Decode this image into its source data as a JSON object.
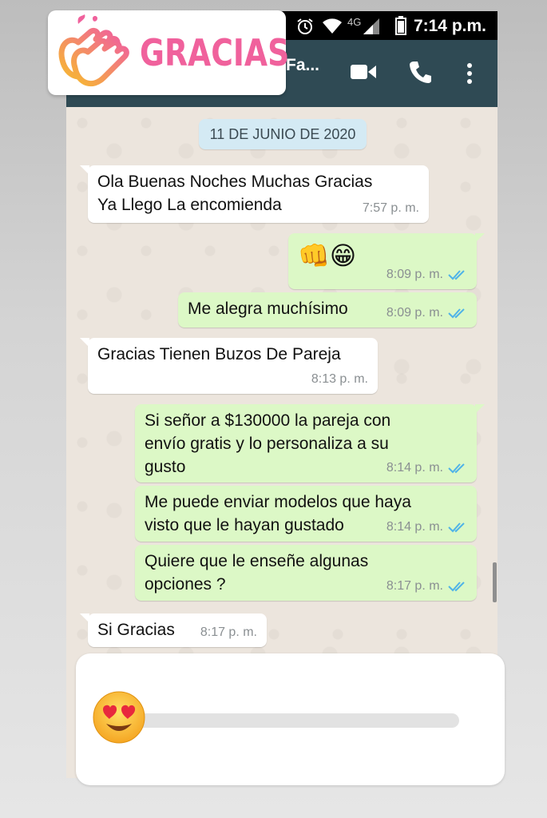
{
  "status_bar": {
    "network": "4G",
    "time": "7:14 p.m.",
    "icons": [
      "alarm-icon",
      "wifi-icon",
      "signal-icon",
      "battery-icon"
    ]
  },
  "app_bar": {
    "contact_name": "Fa...",
    "icons": [
      "video-call-icon",
      "phone-call-icon",
      "more-options-icon"
    ]
  },
  "sticker": {
    "text": "GRACIAS",
    "icon": "clapping-hands-icon",
    "color": "#f0619c"
  },
  "chat": {
    "date": "11 DE JUNIO DE 2020",
    "messages": [
      {
        "dir": "in",
        "lines": [
          "Ola Buenas Noches Muchas Gracias",
          "Ya Llego La encomienda"
        ],
        "time": "7:57 p. m."
      },
      {
        "dir": "out",
        "lines": [
          "👊😁"
        ],
        "time": "8:09 p. m.",
        "read": true
      },
      {
        "dir": "out",
        "lines": [
          "Me alegra muchísimo"
        ],
        "time": "8:09 p. m.",
        "read": true
      },
      {
        "dir": "in",
        "lines": [
          "Gracias Tienen Buzos De Pareja"
        ],
        "time": "8:13 p. m."
      },
      {
        "dir": "out",
        "lines": [
          "Si señor a $130000 la pareja con",
          "envío gratis y lo personaliza a su",
          "gusto"
        ],
        "time": "8:14 p. m.",
        "read": true
      },
      {
        "dir": "out",
        "lines": [
          "Me puede enviar modelos que haya",
          "visto que le hayan gustado"
        ],
        "time": "8:14 p. m.",
        "read": true
      },
      {
        "dir": "out",
        "lines": [
          "Quiere que le enseñe algunas",
          "opciones ?"
        ],
        "time": "8:17 p. m.",
        "read": true
      },
      {
        "dir": "in",
        "lines": [
          "Si Gracias"
        ],
        "time": "8:17 p. m."
      }
    ]
  },
  "reaction_slider": {
    "emoji": "heart-eyes-emoji-icon",
    "value": 0.0
  },
  "colors": {
    "app_bar": "#2f4a54",
    "outgoing_bubble": "#dcf8c6",
    "incoming_bubble": "#ffffff",
    "read_ticks": "#4fb3e8"
  }
}
